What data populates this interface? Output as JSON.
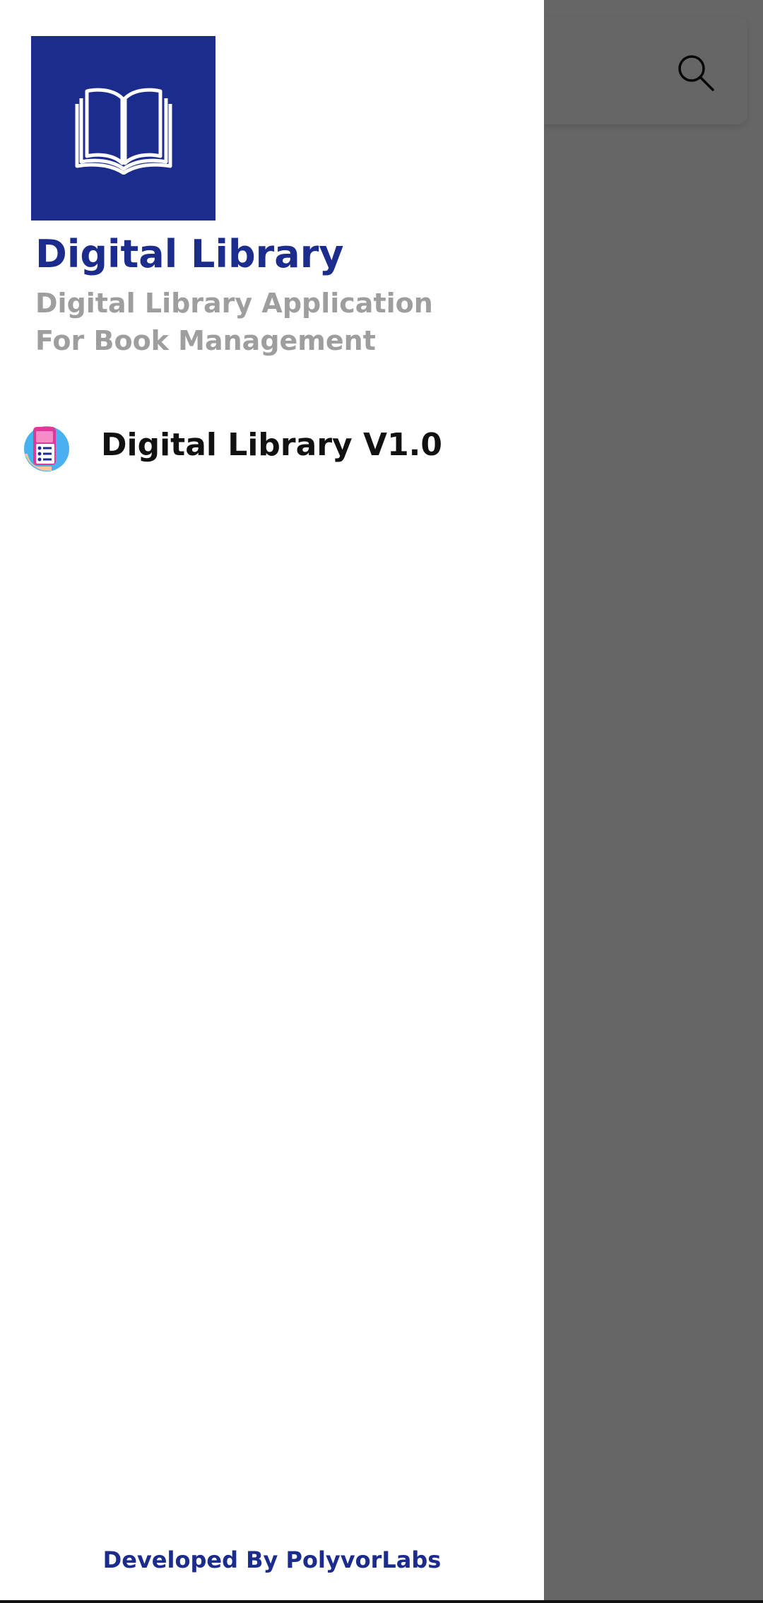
{
  "drawer": {
    "logo_icon": "open-book-icon",
    "title": "Digital Library",
    "subtitle": "Digital Library Application For Book Management",
    "menu_items": [
      {
        "label": "Digital Library V1.0",
        "icon": "phone-list-icon"
      }
    ],
    "footer": "Developed By PolyvorLabs"
  },
  "app_bar": {
    "search_icon": "search-icon"
  },
  "colors": {
    "brand": "#1c2c8c",
    "subtitle": "#9e9e9e",
    "scrim": "rgba(0,0,0,0.6)"
  }
}
